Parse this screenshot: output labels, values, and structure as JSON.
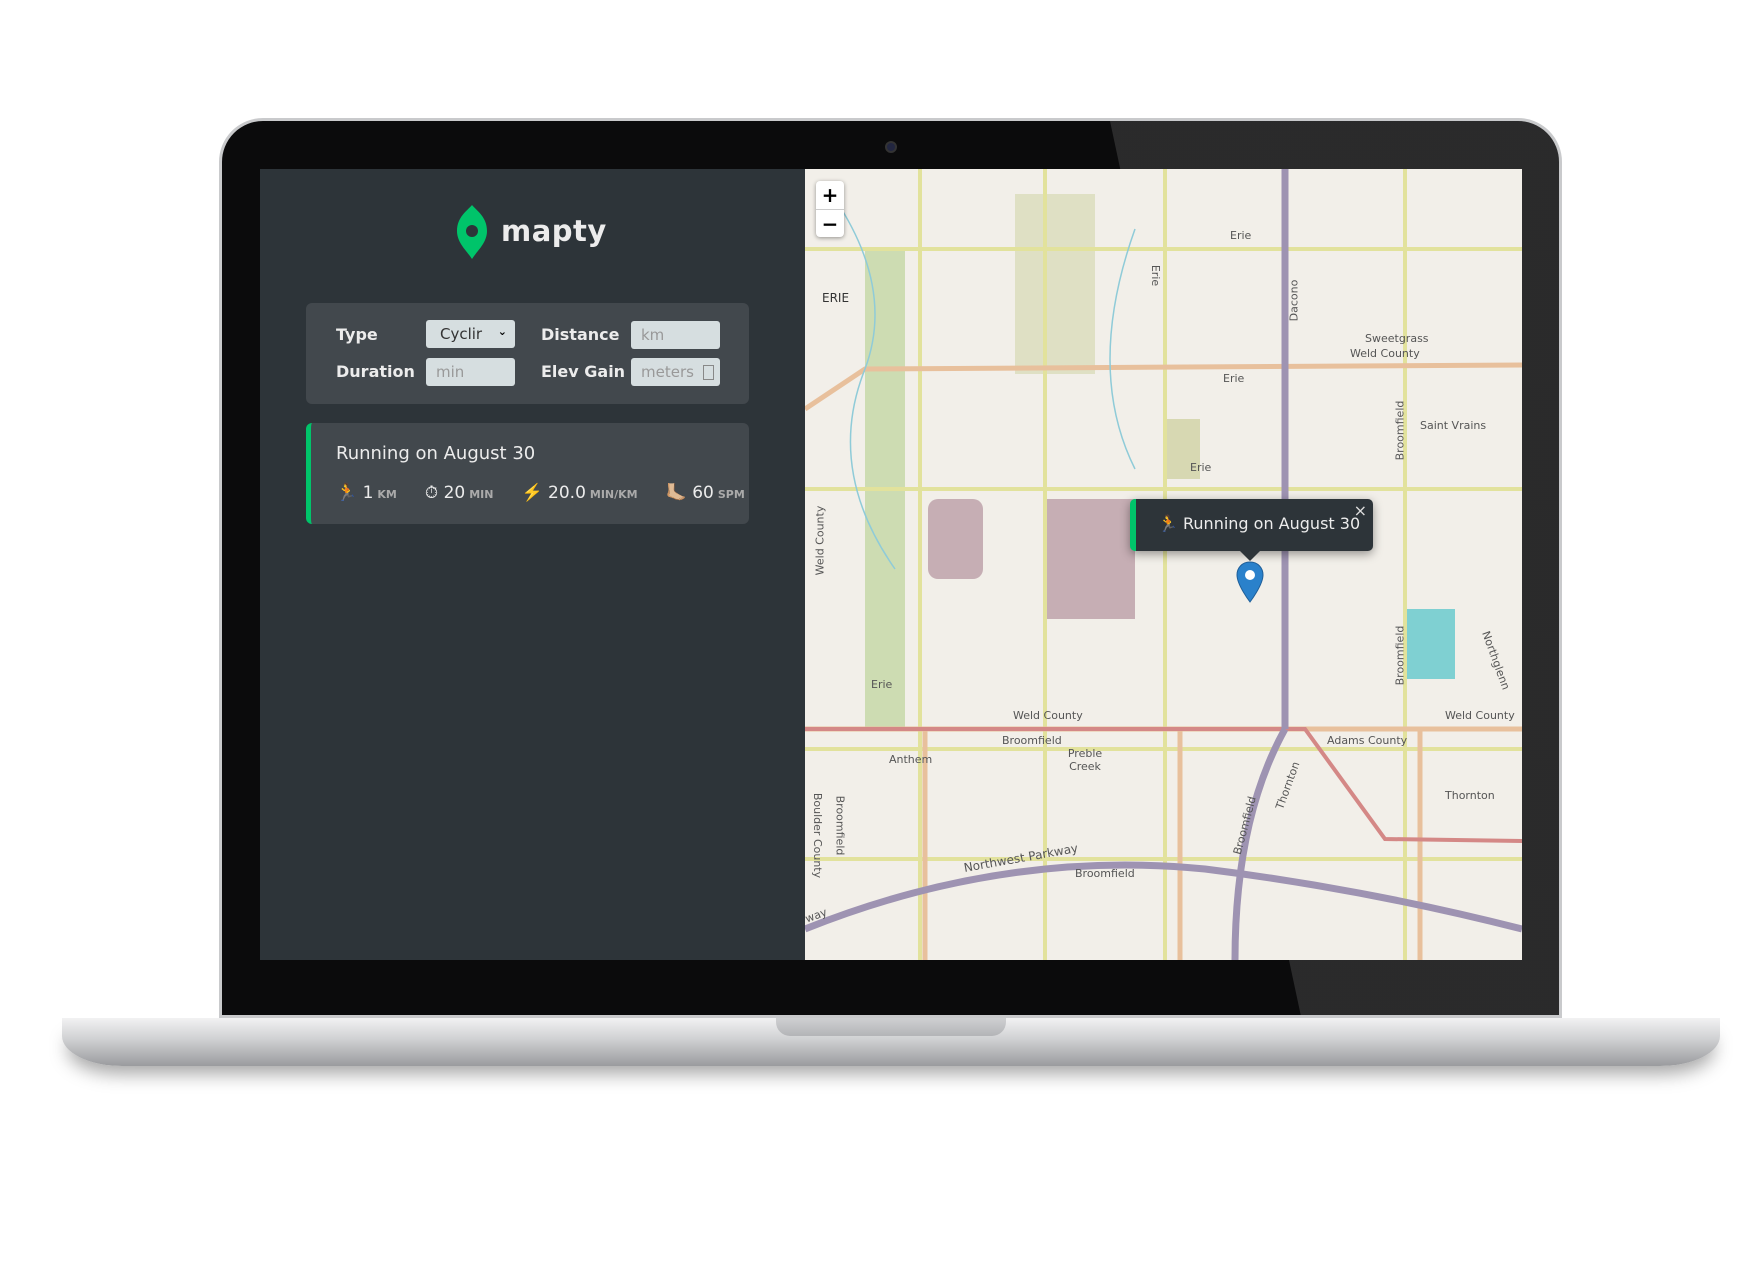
{
  "app": {
    "name": "mapty",
    "accent": "#00c46a",
    "background": "#2d3439",
    "panel": "#42484d"
  },
  "form": {
    "type_label": "Type",
    "type_value": "Cyclir",
    "distance_label": "Distance",
    "distance_placeholder": "km",
    "duration_label": "Duration",
    "duration_placeholder": "min",
    "elev_label": "Elev Gain",
    "elev_placeholder": "meters"
  },
  "workouts": [
    {
      "title": "Running on August 30",
      "details": [
        {
          "icon": "running-icon",
          "glyph": "🏃",
          "value": "1",
          "unit": "KM"
        },
        {
          "icon": "stopwatch-icon",
          "glyph": "⏱",
          "value": "20",
          "unit": "MIN"
        },
        {
          "icon": "lightning-icon",
          "glyph": "⚡️",
          "value": "20.0",
          "unit": "MIN/KM"
        },
        {
          "icon": "foot-icon",
          "glyph": "🦶🏼",
          "value": "60",
          "unit": "SPM"
        }
      ]
    }
  ],
  "map": {
    "zoom_in": "+",
    "zoom_out": "−",
    "popup": {
      "glyph": "🏃",
      "text": "Running on August 30",
      "close": "×"
    },
    "labels": [
      "ERIE",
      "Erie",
      "Erie",
      "Erie",
      "Erie",
      "Erie",
      "Dacono",
      "Sweetgrass",
      "Weld County",
      "Saint Vrains",
      "Broomfield",
      "Broomfield",
      "Weld County",
      "Weld County",
      "Weld County",
      "Broomfield",
      "Preble Creek",
      "Anthem",
      "Adams County",
      "Thornton",
      "Thornton",
      "Northwest Parkway",
      "Broomfield",
      "Broomfield",
      "Broomfield",
      "Northglenn",
      "Boulder County",
      "way"
    ]
  }
}
